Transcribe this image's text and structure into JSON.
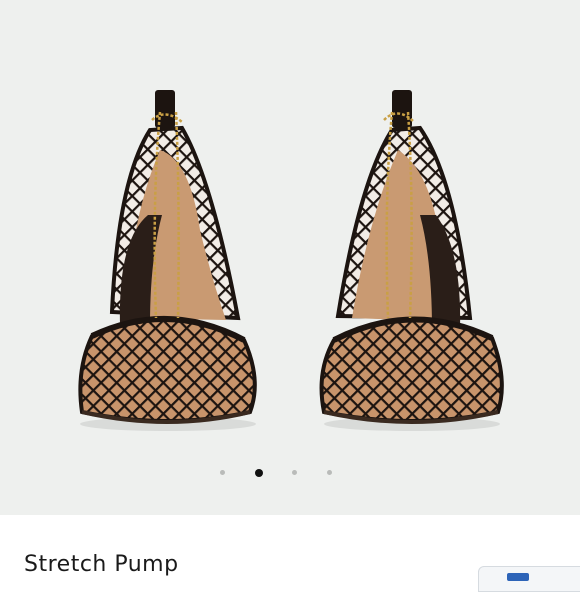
{
  "product": {
    "title": "Stretch Pump"
  },
  "gallery": {
    "image_count": 4,
    "active_index": 1,
    "image_description_icon": "mesh-pump-pair-image"
  },
  "colors": {
    "background": "#eef0ee",
    "dot_active": "#111111",
    "dot_inactive": "#b9bbb9"
  }
}
